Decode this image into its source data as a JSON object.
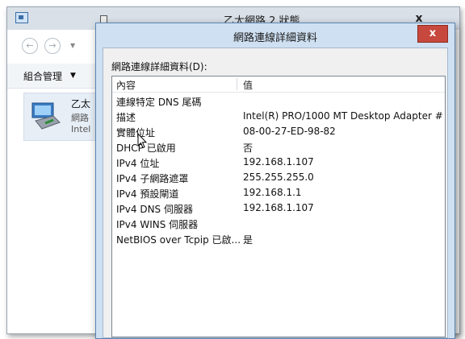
{
  "background_window": {
    "title": "乙太網路 2 狀態",
    "close_label": "x",
    "nav_back": "←",
    "nav_forward": "→",
    "toolbar": {
      "organize_label": "組合管理",
      "organize_caret": "▼"
    },
    "adapter": {
      "name": "乙太",
      "line1": "網路",
      "line2": "Intel"
    }
  },
  "dialog": {
    "title": "網路連線詳細資料",
    "close_label": "x",
    "details_label": "網路連線詳細資料(D):",
    "columns": [
      "內容",
      "值"
    ],
    "rows": [
      {
        "property": "連線特定 DNS 尾碼",
        "value": ""
      },
      {
        "property": "描述",
        "value": "Intel(R) PRO/1000 MT Desktop Adapter #"
      },
      {
        "property": "實體位址",
        "value": "08-00-27-ED-98-82"
      },
      {
        "property": "DHCP 已啟用",
        "value": "否"
      },
      {
        "property": "IPv4 位址",
        "value": "192.168.1.107"
      },
      {
        "property": "IPv4 子網路遮罩",
        "value": "255.255.255.0"
      },
      {
        "property": "IPv4 預設閘道",
        "value": "192.168.1.1"
      },
      {
        "property": "IPv4 DNS 伺服器",
        "value": "192.168.1.107"
      },
      {
        "property": "IPv4 WINS 伺服器",
        "value": ""
      },
      {
        "property": "NetBIOS over Tcpip 已啟...",
        "value": "是"
      }
    ]
  },
  "colors": {
    "dialog_frame": "#cfe0f2",
    "close_button": "#c7483d",
    "selection": "#e7eef6"
  }
}
